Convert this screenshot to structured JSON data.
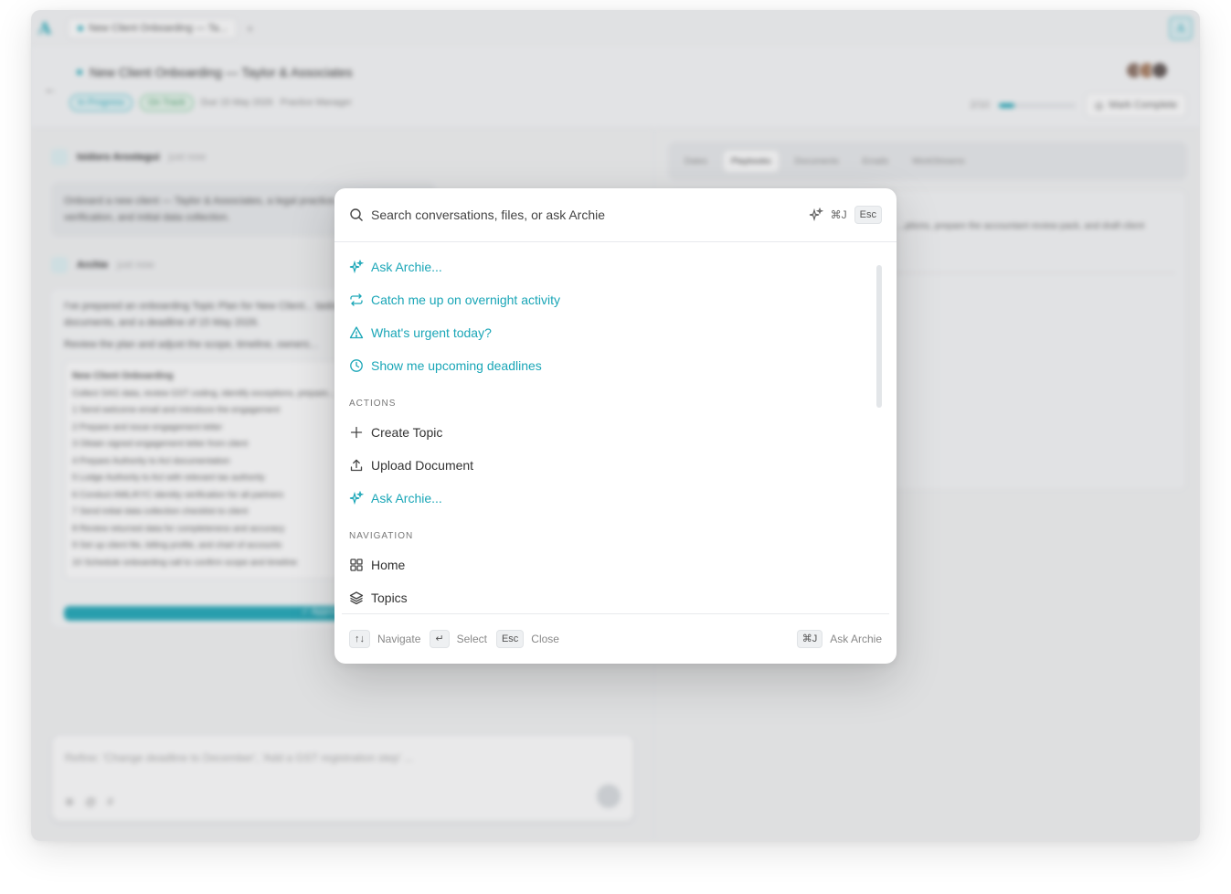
{
  "background": {
    "tab_title": "New Client Onboarding — Ta...",
    "plus": "+",
    "corner_logo": "A",
    "header": {
      "back": "←",
      "title": "New Client Onboarding — Taylor & Associates",
      "status_pill": "In Progress",
      "track_pill": "On Track",
      "due": "Due 15 May 2026",
      "owner": "Practice Manager",
      "progress_text": "2/10",
      "progress_fraction": 0.2,
      "mark_complete": "Mark Complete"
    },
    "left": {
      "user_name": "Isidoro Arostegui",
      "user_time": "just now",
      "user_message": "Onboard a new client — Taylor & Associates, a legal practice... act, AML/KYC verification, and initial data collection.",
      "archie_name": "Archie",
      "archie_time": "just now",
      "archie_p1": "I've prepared an onboarding Topic Plan for New Client... tasks, 6 key documents, and a deadline of 15 May 2026.",
      "archie_p2": "Review the plan and adjust the scope, timeline, owners...",
      "plan_title": "New Client Onboarding",
      "plan_sub": "Collect SAG data, review GST coding, identify exceptions, prepare...",
      "plan_items": [
        "1  Send welcome email and introduce the engagement",
        "2  Prepare and issue engagement letter",
        "3  Obtain signed engagement letter from client",
        "4  Prepare Authority to Act documentation",
        "5  Lodge Authority to Act with relevant tax authority",
        "6  Conduct AML/KYC identity verification for all partners",
        "7  Send initial data collection checklist to client",
        "8  Review returned data for completeness and accuracy",
        "9  Set up client file, billing profile, and chart of accounts",
        "10 Schedule onboarding call to confirm scope and timeline"
      ],
      "approve": "✓ Approve",
      "composer_placeholder": "Refine: 'Change deadline to December', 'Add a GST registration step' ..."
    },
    "right": {
      "tabs": [
        "Dates",
        "Playbooks",
        "Documents",
        "Emails",
        "WorkStreams"
      ],
      "active_tab": "Playbooks",
      "card_line": "...ptions, prepare the accountant review pack, and draft client"
    }
  },
  "palette": {
    "search_placeholder": "Search conversations, files, or ask Archie",
    "shortcut_ai": "⌘J",
    "shortcut_close": "Esc",
    "suggestions": [
      {
        "label": "Ask Archie...",
        "icon": "sparkles-icon"
      },
      {
        "label": "Catch me up on overnight activity",
        "icon": "repeat-icon"
      },
      {
        "label": "What's urgent today?",
        "icon": "warning-icon"
      },
      {
        "label": "Show me upcoming deadlines",
        "icon": "clock-icon"
      }
    ],
    "actions_heading": "ACTIONS",
    "actions": [
      {
        "label": "Create Topic",
        "icon": "plus-icon"
      },
      {
        "label": "Upload Document",
        "icon": "upload-icon"
      },
      {
        "label": "Ask Archie...",
        "icon": "sparkles-icon"
      }
    ],
    "navigation_heading": "NAVIGATION",
    "navigation": [
      {
        "label": "Home",
        "icon": "grid-icon"
      },
      {
        "label": "Topics",
        "icon": "layers-icon"
      }
    ],
    "footer": {
      "navigate_key": "↑↓",
      "navigate": "Navigate",
      "select_key": "↵",
      "select": "Select",
      "close_key": "Esc",
      "close": "Close",
      "ask_key": "⌘J",
      "ask": "Ask Archie"
    },
    "colors": {
      "accent": "#1aa6b7"
    }
  }
}
